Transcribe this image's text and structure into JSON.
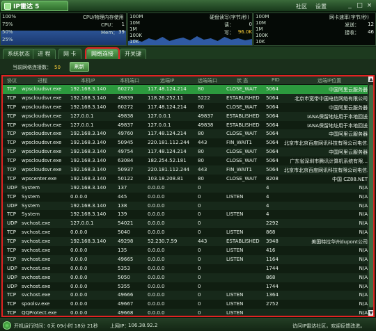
{
  "titlebar": {
    "app_title": "IP雷达 5",
    "links": [
      "社区",
      "设置"
    ],
    "controls": [
      "_",
      "□",
      "×"
    ]
  },
  "monitor": {
    "cpu": {
      "title": "CPU/物理内存使用",
      "scale": [
        "100%",
        "75%",
        "50%",
        "25%"
      ],
      "cpu_label": "CPU：",
      "cpu_value": "1",
      "mem_label": "Mem：",
      "mem_value": "39"
    },
    "disk": {
      "title": "硬盘读写(字节/秒)",
      "scale": [
        "100M",
        "10M",
        "1M",
        "100K",
        "10K"
      ],
      "read_label": "读：",
      "read_value": "0",
      "write_label": "写：",
      "write_value": "96.0K"
    },
    "net": {
      "title": "网卡速率(字节/秒)",
      "scale": [
        "100M",
        "10M",
        "1M",
        "100K",
        "10K"
      ],
      "send_label": "发送：",
      "send_value": "12",
      "recv_label": "接收：",
      "recv_value": "46"
    }
  },
  "tabs": [
    "系统状态",
    "进 程",
    "网 卡",
    "网络连接",
    "开关键"
  ],
  "active_tab_index": 3,
  "toolbar": {
    "conn_label": "当前网络连接数：",
    "conn_count": "50",
    "refresh_label": "刷新"
  },
  "table": {
    "headers": [
      "协议",
      "进程",
      "本机IP",
      "本机端口",
      "远端IP",
      "远端端口",
      "状 态",
      "PID",
      "远端IP位置"
    ],
    "rows": [
      [
        "TCP",
        "wpscloudsvr.exe",
        "192.168.3.140",
        "60273",
        "117.48.124.214",
        "80",
        "CLOSE_WAIT",
        "5064",
        "中国阿里云服务器"
      ],
      [
        "TCP",
        "wpscloudsvr.exe",
        "192.168.3.140",
        "49839",
        "118.26.252.11",
        "5222",
        "ESTABLISHED",
        "5064",
        "北京市宽带中国电信网络有限公司"
      ],
      [
        "TCP",
        "wpscloudsvr.exe",
        "192.168.3.140",
        "60272",
        "117.48.124.214",
        "80",
        "CLOSE_WAIT",
        "5064",
        "中国阿里云服务器"
      ],
      [
        "TCP",
        "wpscloudsvr.exe",
        "127.0.0.1",
        "49838",
        "127.0.0.1",
        "49837",
        "ESTABLISHED",
        "5064",
        "IANA保留地址用于本地回送"
      ],
      [
        "TCP",
        "wpscloudsvr.exe",
        "127.0.0.1",
        "49837",
        "127.0.0.1",
        "49838",
        "ESTABLISHED",
        "5064",
        "IANA保留地址用于本地回送"
      ],
      [
        "TCP",
        "wpscloudsvr.exe",
        "192.168.3.140",
        "49760",
        "117.48.124.214",
        "80",
        "CLOSE_WAIT",
        "5064",
        "中国阿里云服务器"
      ],
      [
        "TCP",
        "wpscloudsvr.exe",
        "192.168.3.140",
        "50945",
        "220.181.112.244",
        "443",
        "FIN_WAIT1",
        "5064",
        "北京市北京百度网讯科技有限公司电信..."
      ],
      [
        "TCP",
        "wpscloudsvr.exe",
        "192.168.3.140",
        "49754",
        "117.48.124.214",
        "80",
        "CLOSE_WAIT",
        "5064",
        "中国阿里云服务器"
      ],
      [
        "TCP",
        "wpscloudsvr.exe",
        "192.168.3.140",
        "63084",
        "182.254.52.181",
        "80",
        "CLOSE_WAIT",
        "5064",
        "广东省深圳市腾讯计算机系统有限..."
      ],
      [
        "TCP",
        "wpscloudsvr.exe",
        "192.168.3.140",
        "50937",
        "220.181.112.244",
        "443",
        "FIN_WAIT1",
        "5064",
        "北京市北京百度网讯科技有限公司电信..."
      ],
      [
        "TCP",
        "wpscenter.exe",
        "192.168.3.140",
        "50122",
        "103.18.208.81",
        "80",
        "CLOSE_WAIT",
        "8208",
        "中国 CZ88.NET"
      ],
      [
        "UDP",
        "System",
        "192.168.3.140",
        "137",
        "0.0.0.0",
        "0",
        "",
        "4",
        "N/A"
      ],
      [
        "TCP",
        "System",
        "0.0.0.0",
        "445",
        "0.0.0.0",
        "0",
        "LISTEN",
        "4",
        "N/A"
      ],
      [
        "UDP",
        "System",
        "192.168.3.140",
        "138",
        "0.0.0.0",
        "0",
        "",
        "4",
        "N/A"
      ],
      [
        "TCP",
        "System",
        "192.168.3.140",
        "139",
        "0.0.0.0",
        "0",
        "LISTEN",
        "4",
        "N/A"
      ],
      [
        "UDP",
        "svchost.exe",
        "127.0.0.1",
        "54021",
        "0.0.0.0",
        "0",
        "",
        "2292",
        "N/A"
      ],
      [
        "TCP",
        "svchost.exe",
        "0.0.0.0",
        "5040",
        "0.0.0.0",
        "0",
        "LISTEN",
        "868",
        "N/A"
      ],
      [
        "TCP",
        "svchost.exe",
        "192.168.3.140",
        "49298",
        "52.230.7.59",
        "443",
        "ESTABLISHED",
        "3948",
        "美国特拉华州dupont公司"
      ],
      [
        "TCP",
        "svchost.exe",
        "0.0.0.0",
        "135",
        "0.0.0.0",
        "0",
        "LISTEN",
        "416",
        "N/A"
      ],
      [
        "TCP",
        "svchost.exe",
        "0.0.0.0",
        "49665",
        "0.0.0.0",
        "0",
        "LISTEN",
        "1164",
        "N/A"
      ],
      [
        "UDP",
        "svchost.exe",
        "0.0.0.0",
        "5353",
        "0.0.0.0",
        "0",
        "",
        "1744",
        "N/A"
      ],
      [
        "UDP",
        "svchost.exe",
        "0.0.0.0",
        "5050",
        "0.0.0.0",
        "0",
        "",
        "868",
        "N/A"
      ],
      [
        "UDP",
        "svchost.exe",
        "0.0.0.0",
        "5355",
        "0.0.0.0",
        "0",
        "",
        "1744",
        "N/A"
      ],
      [
        "TCP",
        "svchost.exe",
        "0.0.0.0",
        "49666",
        "0.0.0.0",
        "0",
        "LISTEN",
        "1364",
        "N/A"
      ],
      [
        "TCP",
        "spoolsv.exe",
        "0.0.0.0",
        "49667",
        "0.0.0.0",
        "0",
        "LISTEN",
        "2752",
        "N/A"
      ],
      [
        "TCP",
        "QQProtect.exe",
        "0.0.0.0",
        "49668",
        "0.0.0.0",
        "0",
        "LISTEN",
        "",
        "N/A"
      ]
    ],
    "selected_row": 0
  },
  "status": {
    "uptime_label": "开机运行时间：",
    "uptime_value": "0天 09小时 18分 21秒",
    "ip_label": "上网IP：",
    "ip_value": "106.38.92.2",
    "right_text": "访问IP雷达社区，欢迎反馈改进。"
  }
}
